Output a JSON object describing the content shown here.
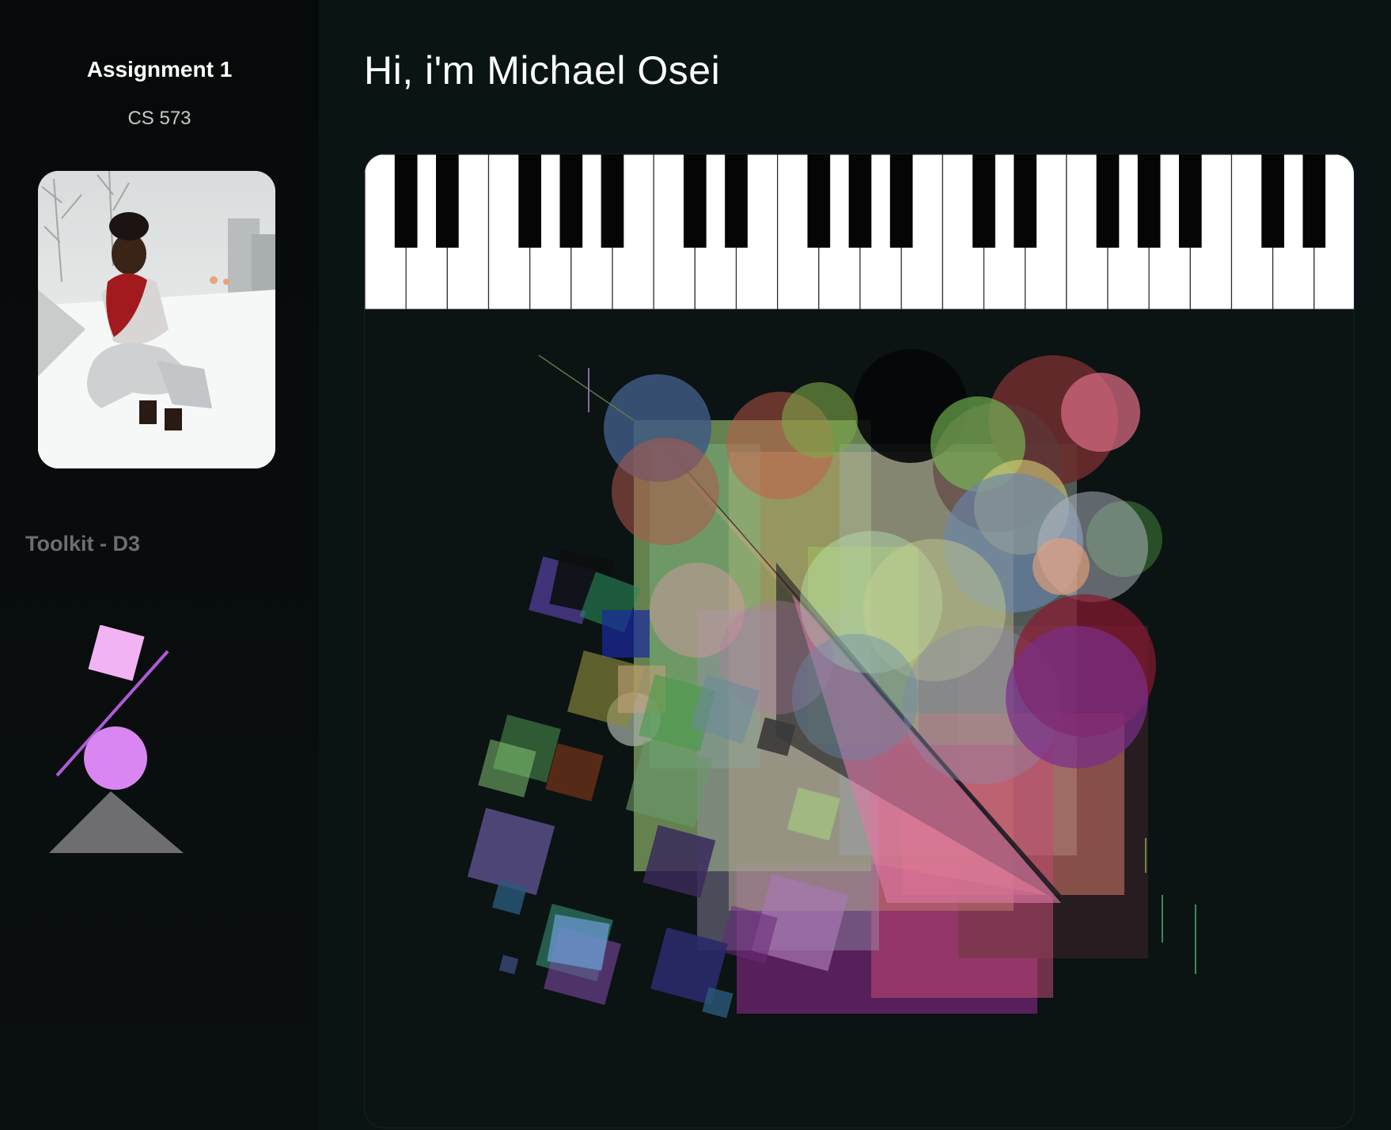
{
  "sidebar": {
    "title": "Assignment 1",
    "subtitle": "CS 573",
    "toolkit_label": "Toolkit - D3"
  },
  "main": {
    "heading": "Hi, i'm Michael Osei"
  },
  "colors": {
    "background": "#0b1414",
    "sidebar_background": "#080c0c",
    "heading_text": "#ffffff",
    "toolkit_label": "#6b6f6f",
    "logo_square": "#f2b3f5",
    "logo_circle": "#d986f2",
    "logo_line": "#b05ad8",
    "logo_triangle": "#6e6e72"
  },
  "piano": {
    "white_keys": 24,
    "black_key_pattern": [
      "C#",
      "D#",
      "F#",
      "G#",
      "A#"
    ]
  }
}
